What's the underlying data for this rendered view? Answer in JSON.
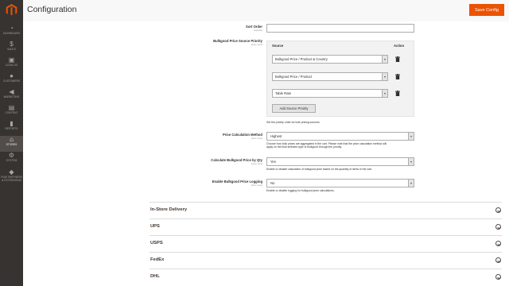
{
  "header": {
    "title": "Configuration",
    "save_label": "Save Config"
  },
  "sidebar": {
    "items": [
      {
        "label": "Dashboard",
        "icon": "dashboard-icon"
      },
      {
        "label": "Sales",
        "icon": "dollar-icon"
      },
      {
        "label": "Catalog",
        "icon": "box-icon"
      },
      {
        "label": "Customers",
        "icon": "customers-icon"
      },
      {
        "label": "Marketing",
        "icon": "megaphone-icon"
      },
      {
        "label": "Content",
        "icon": "content-icon"
      },
      {
        "label": "Reports",
        "icon": "bar-chart-icon"
      },
      {
        "label": "Stores",
        "icon": "store-icon"
      },
      {
        "label": "System",
        "icon": "gear-icon"
      },
      {
        "label": "Find Partners & Extensions",
        "icon": "partners-icon"
      }
    ],
    "active": "Stores"
  },
  "form": {
    "sort_order": {
      "label": "Sort Order",
      "scope": "[website]",
      "value": ""
    },
    "source_priority": {
      "label": "Bulkgood Price Source Priority",
      "scope": "[store view]",
      "col_source": "Source",
      "col_action": "Action",
      "rows": [
        {
          "value": "Bulkgood Price / Product & Country"
        },
        {
          "value": "Bulkgood Price / Product"
        },
        {
          "value": "Table Rate"
        }
      ],
      "add_label": "Add Source Priority",
      "note": "Set the priority order for bulk pricing sources."
    },
    "calc_method": {
      "label": "Price Calculation Method",
      "scope": "[store view]",
      "value": "Highest",
      "note1": "Choose how bulk prices are aggregated in the cart. Please note that the price calculation method will",
      "note2": "apply on the final selected type of bulkgood through the priority."
    },
    "calc_by_qty": {
      "label": "Calculate Bulkgood Price by Qty",
      "scope": "[store view]",
      "value": "Yes",
      "note": "Enable or disable calculation of bulkgood price based on the quantity of items in the cart."
    },
    "logging": {
      "label": "Enable Bulkgood Price Logging",
      "scope": "[store view]",
      "value": "No",
      "note": "Enable or disable logging for bulkgood price calculations."
    }
  },
  "sections": [
    {
      "title": "In-Store Delivery"
    },
    {
      "title": "UPS"
    },
    {
      "title": "USPS"
    },
    {
      "title": "FedEx"
    },
    {
      "title": "DHL"
    }
  ],
  "colors": {
    "accent": "#eb5202",
    "sidebar": "#373330",
    "sidebar_active": "#524d49"
  }
}
